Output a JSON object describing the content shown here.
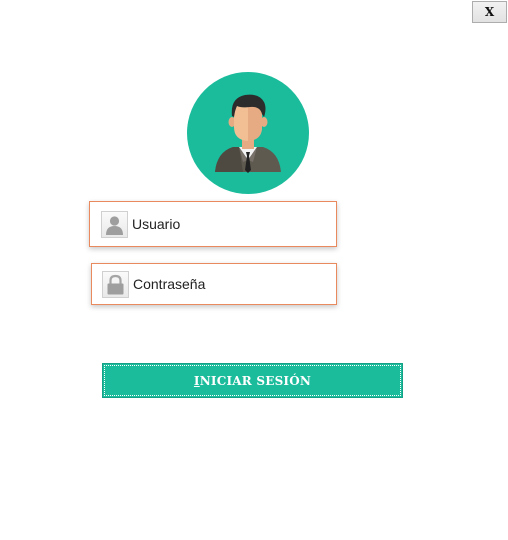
{
  "window": {
    "close_label": "X"
  },
  "login": {
    "avatar_icon": "user-avatar-icon",
    "username_placeholder": "Usuario",
    "username_icon": "user-icon",
    "password_placeholder": "Contraseña",
    "password_icon": "lock-icon",
    "submit_mnemonic": "I",
    "submit_rest": "NICIAR SESIÓN"
  },
  "colors": {
    "accent": "#1abc9c",
    "field_border": "#e98a5e"
  }
}
